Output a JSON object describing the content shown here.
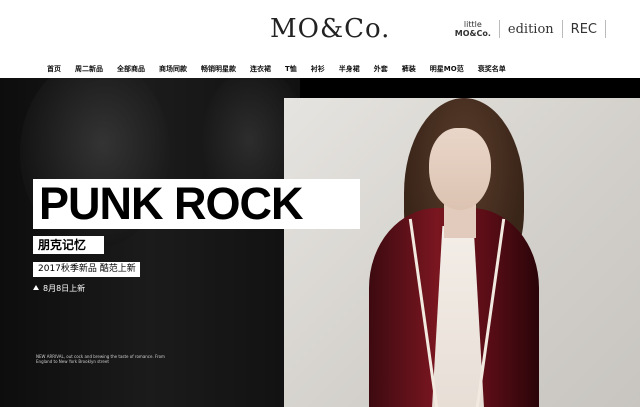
{
  "brand": {
    "logo": "MO&Co.",
    "sub_brands": [
      {
        "line1": "little",
        "line2": "MO&Co."
      },
      {
        "label": "edition"
      },
      {
        "label": "REC"
      }
    ]
  },
  "nav": {
    "items": [
      "首页",
      "周二新品",
      "全部商品",
      "商场同款",
      "畅销明星款",
      "连衣裙",
      "T恤",
      "衬衫",
      "半身裙",
      "外套",
      "裤装",
      "明星MO范",
      "衰奖名单"
    ],
    "search_placeholder": ""
  },
  "hero": {
    "title": "PUNK ROCK",
    "subtitle_cn": "朋克记忆",
    "season": "2017秋季新品 酷范上新",
    "launch": "8月8日上新",
    "fine_print": "NEW ARRIVAL, out cock and brewing the taste of romance. From England to New York Brooklyn street"
  },
  "colors": {
    "accent": "#000000",
    "coat": "#7a1620"
  }
}
